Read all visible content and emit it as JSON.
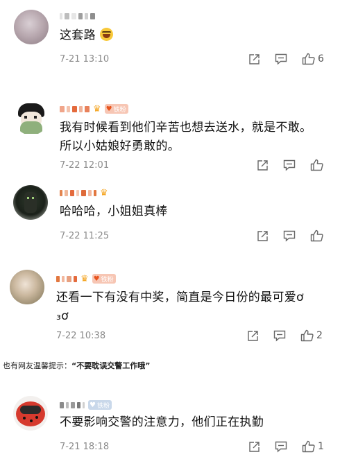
{
  "comments": [
    {
      "text": "这套路",
      "time": "7-21 13:10",
      "likes": "6",
      "avatar_icon": "blurred-avatar",
      "has_emoji": true
    },
    {
      "text_line1": "我有时候看到他们辛苦也想去送水，就是不敢。",
      "text_line2": "所以小姑娘好勇敢的。",
      "time": "7-22 12:01",
      "badge_label": "铁粉",
      "likes": ""
    },
    {
      "text": "哈哈哈，小姐姐真棒",
      "time": "7-22 11:25",
      "likes": ""
    },
    {
      "text_line1": "还看一下有没有中奖，简直是今日份的最可爱ơ",
      "text_line2": "₃ơ",
      "time": "7-22 10:38",
      "badge_label": "铁粉",
      "likes": "2"
    },
    {
      "text": "不要影响交警的注意力，他们正在执勤",
      "time": "7-21 18:18",
      "badge_label": "铁粉",
      "likes": "1"
    }
  ],
  "note": {
    "prefix": "也有网友温馨提示：",
    "quote": "“不要耽误交警工作哦”"
  },
  "colors": {
    "meta_text": "#8a8a8a",
    "badge_bg": "#f7c6b4",
    "badge_heart": "#e8541e"
  }
}
